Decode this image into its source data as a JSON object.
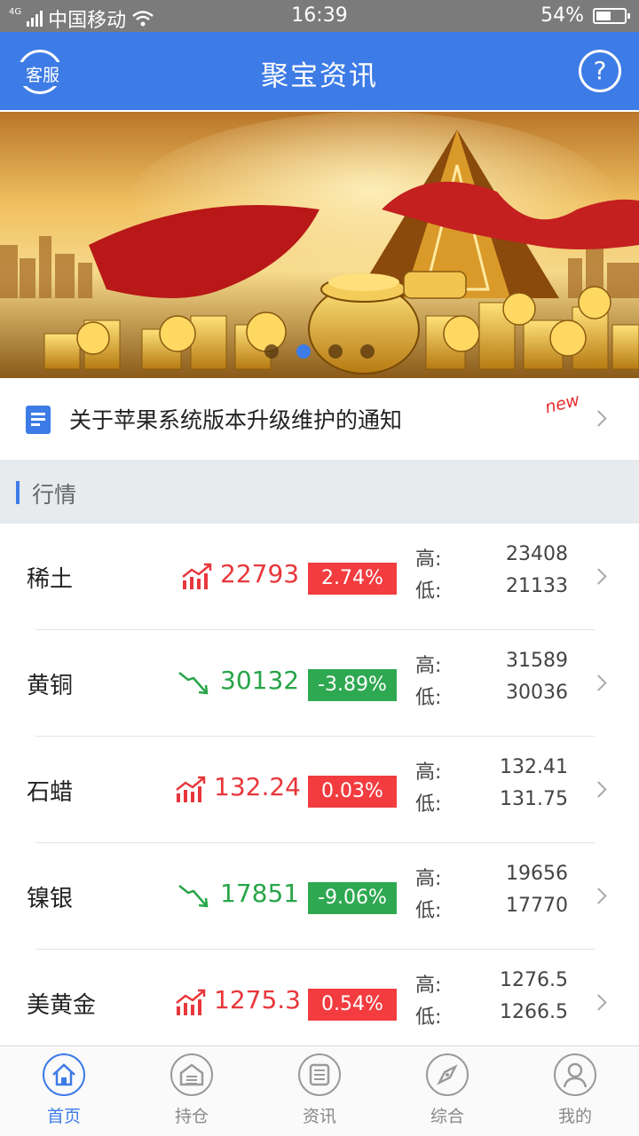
{
  "status_bar": {
    "network": "4G",
    "carrier": "中国移动",
    "time": "16:39",
    "battery": "54%",
    "battery_level": 0.54
  },
  "header": {
    "title": "聚宝资讯",
    "left_button": "客服",
    "help_button": "?"
  },
  "banner": {
    "slide_count": 4,
    "active_index": 1
  },
  "notice": {
    "text": "关于苹果系统版本升级维护的通知",
    "badge": "new"
  },
  "section": {
    "title": "行情"
  },
  "market": [
    {
      "name": "稀土",
      "price": "22793",
      "change": "2.74%",
      "direction": "up",
      "high_label": "高:",
      "high": "23408",
      "low_label": "低:",
      "low": "21133"
    },
    {
      "name": "黄铜",
      "price": "30132",
      "change": "-3.89%",
      "direction": "down",
      "high_label": "高:",
      "high": "31589",
      "low_label": "低:",
      "low": "30036"
    },
    {
      "name": "石蜡",
      "price": "132.24",
      "change": "0.03%",
      "direction": "up",
      "high_label": "高:",
      "high": "132.41",
      "low_label": "低:",
      "low": "131.75"
    },
    {
      "name": "镍银",
      "price": "17851",
      "change": "-9.06%",
      "direction": "down",
      "high_label": "高:",
      "high": "19656",
      "low_label": "低:",
      "low": "17770"
    },
    {
      "name": "美黄金",
      "price": "1275.3",
      "change": "0.54%",
      "direction": "up",
      "high_label": "高:",
      "high": "1276.5",
      "low_label": "低:",
      "low": "1266.5"
    }
  ],
  "tabs": [
    {
      "label": "首页",
      "icon": "home-icon",
      "active": true
    },
    {
      "label": "持仓",
      "icon": "warehouse-icon",
      "active": false
    },
    {
      "label": "资讯",
      "icon": "news-icon",
      "active": false
    },
    {
      "label": "综合",
      "icon": "compass-icon",
      "active": false
    },
    {
      "label": "我的",
      "icon": "user-icon",
      "active": false
    }
  ],
  "colors": {
    "brand": "#3d7be6",
    "up": "#f23c3f",
    "down": "#2ea851"
  }
}
